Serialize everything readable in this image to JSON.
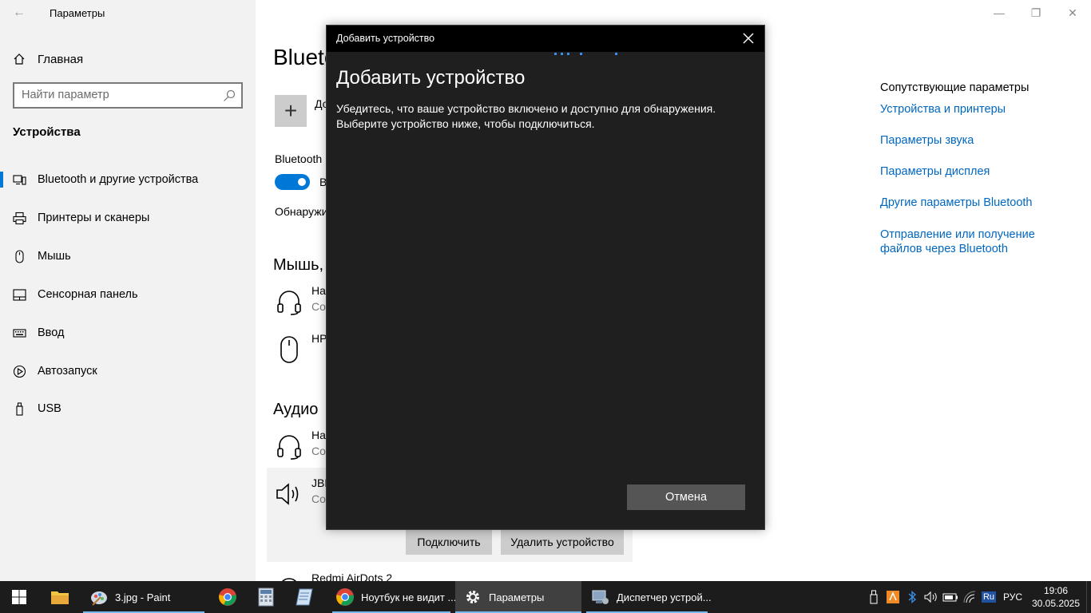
{
  "window": {
    "title": "Параметры",
    "back_glyph": "←"
  },
  "sidebar": {
    "home_label": "Главная",
    "search_placeholder": "Найти параметр",
    "section_title": "Устройства",
    "items": [
      {
        "label": "Bluetooth и другие устройства",
        "icon": "bluetooth-devices-icon",
        "active": true
      },
      {
        "label": "Принтеры и сканеры",
        "icon": "printer-icon",
        "active": false
      },
      {
        "label": "Мышь",
        "icon": "mouse-icon",
        "active": false
      },
      {
        "label": "Сенсорная панель",
        "icon": "touchpad-icon",
        "active": false
      },
      {
        "label": "Ввод",
        "icon": "keyboard-icon",
        "active": false
      },
      {
        "label": "Автозапуск",
        "icon": "autoplay-icon",
        "active": false
      },
      {
        "label": "USB",
        "icon": "usb-icon",
        "active": false
      }
    ]
  },
  "main": {
    "heading": "Bluetooth",
    "add_text": "До",
    "bt_label": "Bluetooth",
    "bt_state": "В",
    "discover_text": "Обнаружи",
    "mouse_group": "Мышь,",
    "devices_mouse": [
      {
        "name": "Ha",
        "sub": "Co",
        "icon": "headset-icon"
      },
      {
        "name": "HP",
        "sub": "",
        "icon": "mouse-icon"
      }
    ],
    "audio_group": "Аудио",
    "devices_audio": [
      {
        "name": "Ha",
        "sub": "Co",
        "icon": "headset-icon"
      },
      {
        "name": "JBL",
        "sub": "Co",
        "icon": "speaker-icon"
      },
      {
        "name": "Redmi AirDots 2",
        "sub": "",
        "icon": "headset-icon"
      }
    ],
    "connect_label": "Подключить",
    "remove_label": "Удалить устройство"
  },
  "related": {
    "title": "Сопутствующие параметры",
    "links": [
      "Устройства и принтеры",
      "Параметры звука",
      "Параметры дисплея",
      "Другие параметры Bluetooth",
      "Отправление или получение файлов через Bluetooth"
    ]
  },
  "dialog": {
    "titlebar": "Добавить устройство",
    "heading": "Добавить устройство",
    "desc_line1": "Убедитесь, что ваше устройство включено и доступно для обнаружения.",
    "desc_line2": "Выберите устройство ниже, чтобы подключиться.",
    "cancel_label": "Отмена"
  },
  "taskbar": {
    "apps": [
      {
        "label": "3.jpg - Paint",
        "icon": "paint-icon"
      },
      {
        "label": "",
        "icon": "chrome-icon"
      },
      {
        "label": "",
        "icon": "calculator-icon"
      },
      {
        "label": "",
        "icon": "notepad-icon"
      },
      {
        "label": "Ноутбук не видит ...",
        "icon": "chrome-icon"
      },
      {
        "label": "Параметры",
        "icon": "settings-gear-icon"
      },
      {
        "label": "Диспетчер устрой...",
        "icon": "device-manager-icon"
      }
    ],
    "lang_badge": "Ru",
    "lang": "РУС",
    "time": "19:06",
    "date": "30.05.2025"
  },
  "colors": {
    "accent": "#0078d7",
    "link": "#0067c0",
    "dialog_bg": "#1f1f1f",
    "taskbar_bg": "#1c1c1c"
  }
}
